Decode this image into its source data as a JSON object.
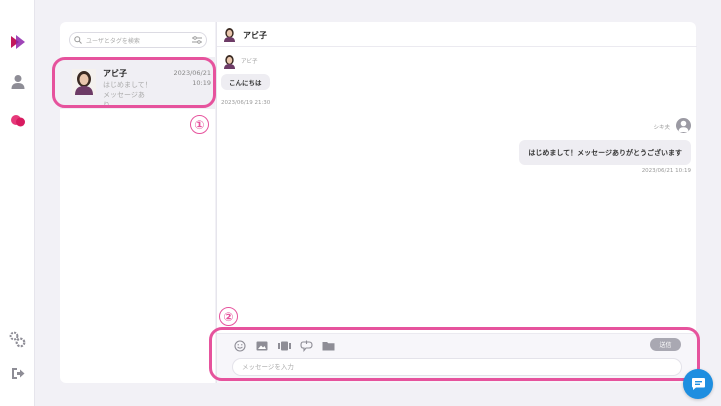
{
  "colors": {
    "accent": "#e6539d",
    "brand_logo": "#c2185b",
    "fab": "#1e8ee0",
    "send_button": "#a9a8b2"
  },
  "nav": {
    "items": [
      {
        "icon": "brand-logo-icon"
      },
      {
        "icon": "user-icon"
      },
      {
        "icon": "chat-bubbles-icon"
      },
      {
        "icon": "settings-gear-icon"
      },
      {
        "icon": "logout-icon"
      }
    ]
  },
  "search": {
    "placeholder": "ユーザとタグを検索"
  },
  "contacts": [
    {
      "name": "アビ子",
      "preview": "はじめまして！メッセージあり...",
      "date": "2023/06/21",
      "time": "10:19"
    }
  ],
  "annotations": {
    "marker1": "①",
    "marker2": "②"
  },
  "chat": {
    "header_name": "アビ子",
    "messages": [
      {
        "sender": "アビ子",
        "text": "こんにちは",
        "timestamp": "2023/06/19 21:30",
        "direction": "incoming"
      },
      {
        "sender": "シキ夫",
        "text": "はじめまして！メッセージありがとうございます",
        "timestamp": "2023/06/21 10:19",
        "direction": "outgoing"
      }
    ]
  },
  "composer": {
    "tools": [
      "emoji-icon",
      "image-icon",
      "video-icon",
      "attach-link-icon",
      "folder-icon"
    ],
    "send_label": "送信",
    "placeholder": "メッセージを入力"
  }
}
